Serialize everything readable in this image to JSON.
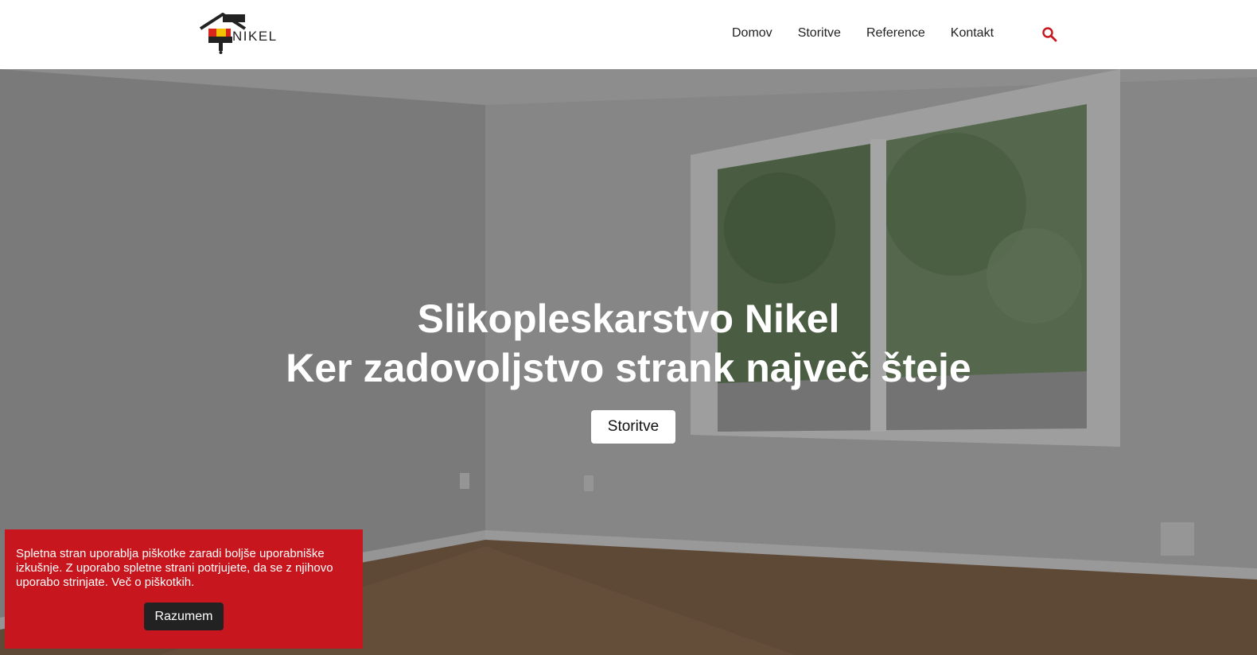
{
  "brand": {
    "name": "NIKEL"
  },
  "nav": {
    "items": [
      {
        "label": "Domov"
      },
      {
        "label": "Storitve"
      },
      {
        "label": "Reference"
      },
      {
        "label": "Kontakt"
      }
    ],
    "search_icon": "search-icon"
  },
  "hero": {
    "title_line1": "Slikopleskarstvo Nikel",
    "title_line2": "Ker zadovoljstvo strank največ šteje",
    "button_label": "Storitve"
  },
  "cookie": {
    "text": "Spletna stran uporablja piškotke zaradi boljše uporabniške izkušnje. Z uporabo spletne strani potrjujete, da se z njihovo uporabo strinjate. Več o piškotkih.",
    "button_label": "Razumem"
  },
  "colors": {
    "accent": "#c7161d",
    "logo_red": "#d9261c",
    "logo_yellow": "#f2c200",
    "search": "#c7161d"
  }
}
